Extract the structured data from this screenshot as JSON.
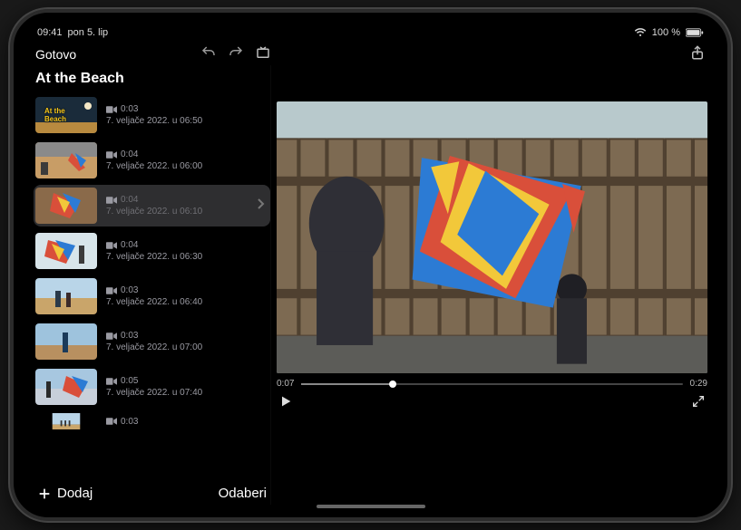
{
  "status": {
    "time": "09:41",
    "date": "pon 5. lip",
    "battery": "100 %"
  },
  "toolbar": {
    "done_label": "Gotovo"
  },
  "project": {
    "title": "At the Beach"
  },
  "clips": [
    {
      "duration": "0:03",
      "date": "7. veljače 2022. u 06:50",
      "title_overlay": "At the\nBeach",
      "selected": false
    },
    {
      "duration": "0:04",
      "date": "7. veljače 2022. u 06:00",
      "selected": false
    },
    {
      "duration": "0:04",
      "date": "7. veljače 2022. u 06:10",
      "selected": true
    },
    {
      "duration": "0:04",
      "date": "7. veljače 2022. u 06:30",
      "selected": false
    },
    {
      "duration": "0:03",
      "date": "7. veljače 2022. u 06:40",
      "selected": false
    },
    {
      "duration": "0:03",
      "date": "7. veljače 2022. u 07:00",
      "selected": false
    },
    {
      "duration": "0:05",
      "date": "7. veljače 2022. u 07:40",
      "selected": false
    },
    {
      "duration": "0:03",
      "date": "",
      "selected": false
    }
  ],
  "sidebar_footer": {
    "add_label": "Dodaj",
    "select_label": "Odaberi"
  },
  "player": {
    "current_time": "0:07",
    "total_time": "0:29"
  }
}
